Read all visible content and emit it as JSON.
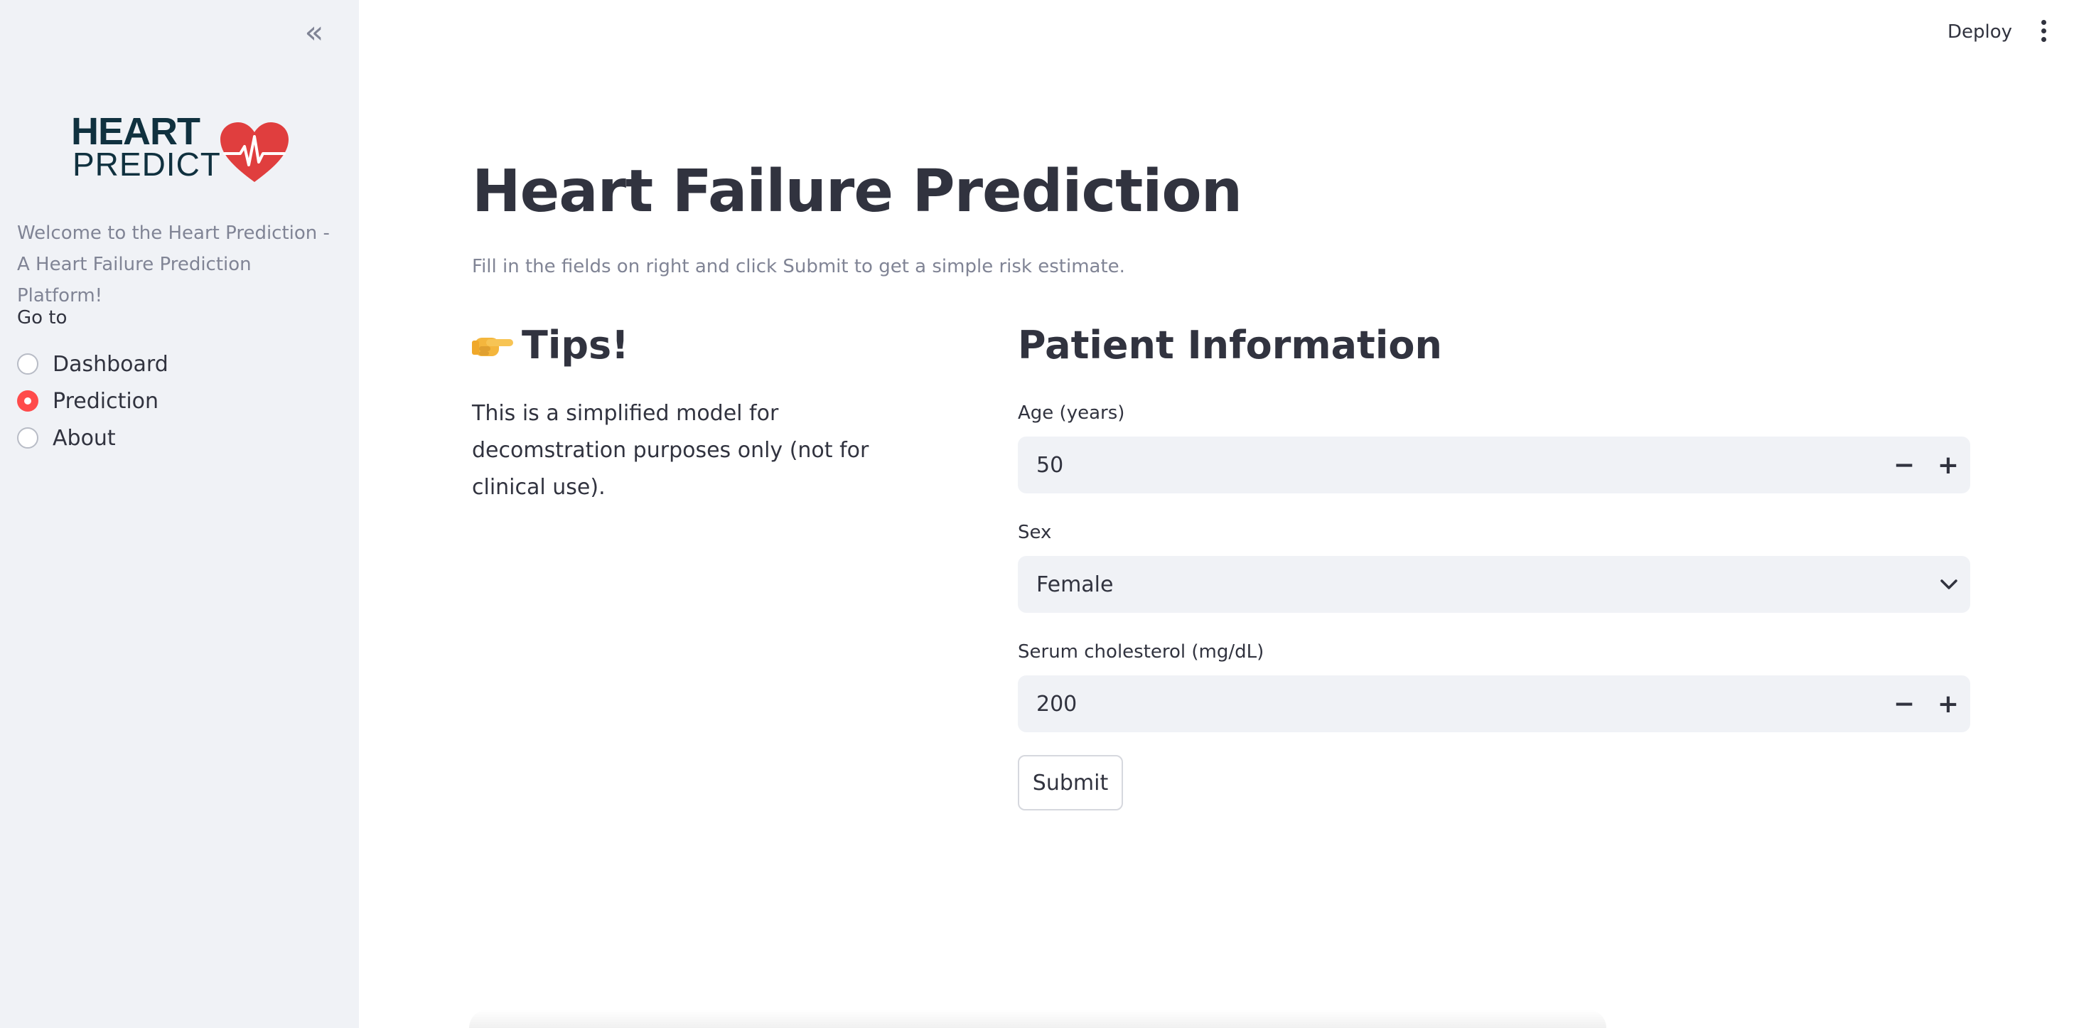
{
  "sidebar": {
    "logo": {
      "line1": "HEART",
      "line2": "PREDICT"
    },
    "welcome_text": "Welcome to the Heart Prediction - A Heart Failure Prediction Platform!",
    "nav_label": "Go to",
    "nav_items": [
      {
        "label": "Dashboard",
        "selected": false
      },
      {
        "label": "Prediction",
        "selected": true
      },
      {
        "label": "About",
        "selected": false
      }
    ]
  },
  "header": {
    "deploy_label": "Deploy"
  },
  "main": {
    "title": "Heart Failure Prediction",
    "subtitle": "Fill in the fields on right and click Submit to get a simple risk estimate.",
    "tips": {
      "heading": "Tips!",
      "body": "This is a simplified model for decomstration purposes only (not for clinical use)."
    },
    "form": {
      "heading": "Patient Information",
      "age_label": "Age (years)",
      "age_value": "50",
      "sex_label": "Sex",
      "sex_value": "Female",
      "cholesterol_label": "Serum cholesterol (mg/dL)",
      "cholesterol_value": "200",
      "minus_label": "−",
      "plus_label": "+",
      "submit_label": "Submit"
    }
  },
  "colors": {
    "accent": "#ff4b4b",
    "sidebar_bg": "#f0f2f6",
    "text": "#31333f",
    "muted": "#808495",
    "logo_navy": "#10313f",
    "logo_red": "#e03e3e"
  }
}
